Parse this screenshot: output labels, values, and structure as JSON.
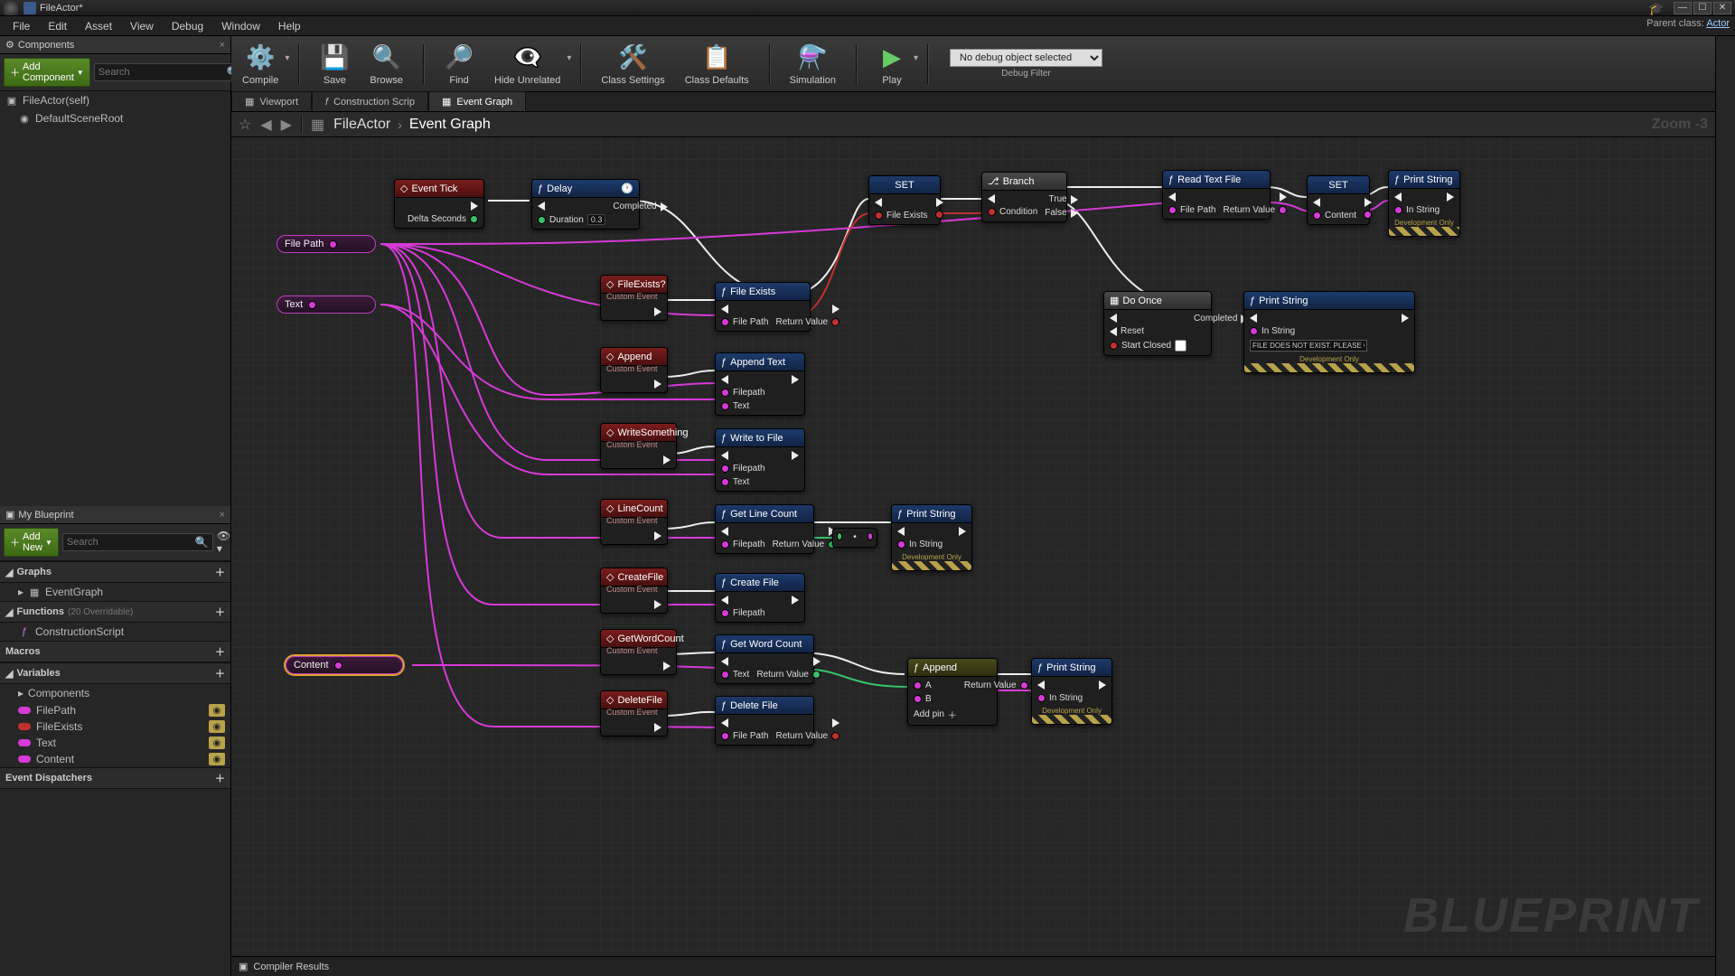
{
  "title": "FileActor*",
  "parentClassLabel": "Parent class:",
  "parentClass": "Actor",
  "menus": [
    "File",
    "Edit",
    "Asset",
    "View",
    "Debug",
    "Window",
    "Help"
  ],
  "componentsPanel": {
    "tab": "Components",
    "addBtn": "Add Component",
    "search": "Search",
    "root": "FileActor(self)",
    "child": "DefaultSceneRoot"
  },
  "blueprintPanel": {
    "tab": "My Blueprint",
    "addBtn": "Add New",
    "search": "Search",
    "graphs": "Graphs",
    "eventGraph": "EventGraph",
    "functions": "Functions",
    "functionsSub": "(20 Overridable)",
    "construction": "ConstructionScript",
    "macros": "Macros",
    "variables": "Variables",
    "componentsCat": "Components",
    "vars": [
      "FilePath",
      "FileExists",
      "Text",
      "Content"
    ],
    "dispatchers": "Event Dispatchers"
  },
  "toolbar": {
    "compile": "Compile",
    "save": "Save",
    "browse": "Browse",
    "find": "Find",
    "hide": "Hide Unrelated",
    "settings": "Class Settings",
    "defaults": "Class Defaults",
    "simulation": "Simulation",
    "play": "Play",
    "debugSel": "No debug object selected",
    "debugLabel": "Debug Filter"
  },
  "docTabs": {
    "viewport": "Viewport",
    "construction": "Construction Scrip",
    "eventGraph": "Event Graph"
  },
  "crumb": {
    "file": "FileActor",
    "graph": "Event Graph",
    "zoom": "Zoom  -3"
  },
  "compiler": "Compiler Results",
  "watermark": "BLUEPRINT",
  "nodes": {
    "eventTick": {
      "title": "Event Tick",
      "delta": "Delta Seconds"
    },
    "delay": {
      "title": "Delay",
      "duration": "Duration",
      "durVal": "0.3",
      "completed": "Completed"
    },
    "filePath": "File Path",
    "text": "Text",
    "content": "Content",
    "fileExistsEvt": {
      "title": "FileExists?",
      "sub": "Custom Event"
    },
    "fileExists": {
      "title": "File Exists",
      "path": "File Path",
      "ret": "Return Value"
    },
    "set": {
      "title": "SET",
      "var": "File Exists"
    },
    "branch": {
      "title": "Branch",
      "cond": "Condition",
      "t": "True",
      "f": "False"
    },
    "readText": {
      "title": "Read Text File",
      "path": "File Path",
      "ret": "Return Value"
    },
    "set2": {
      "title": "SET",
      "var": "Content"
    },
    "printStr": {
      "title": "Print String",
      "in": "In String",
      "dev": "Development Only"
    },
    "doOnce": {
      "title": "Do Once",
      "reset": "Reset",
      "start": "Start Closed",
      "completed": "Completed"
    },
    "printErr": {
      "title": "Print String",
      "in": "In String",
      "val": "FILE DOES NOT EXIST. PLEASE CHECK FILEPATH!!",
      "dev": "Development Only"
    },
    "appendEvt": {
      "title": "Append",
      "sub": "Custom Event"
    },
    "appendText": {
      "title": "Append Text",
      "path": "Filepath",
      "text": "Text"
    },
    "writeEvt": {
      "title": "WriteSomething",
      "sub": "Custom Event"
    },
    "writeFile": {
      "title": "Write to File",
      "path": "Filepath",
      "text": "Text"
    },
    "lineCountEvt": {
      "title": "LineCount",
      "sub": "Custom Event"
    },
    "getLine": {
      "title": "Get Line Count",
      "path": "Filepath",
      "ret": "Return Value"
    },
    "printLine": {
      "title": "Print String",
      "in": "In String",
      "dev": "Development Only"
    },
    "createEvt": {
      "title": "CreateFile",
      "sub": "Custom Event"
    },
    "createFile": {
      "title": "Create File",
      "path": "Filepath"
    },
    "wordCountEvt": {
      "title": "GetWordCount",
      "sub": "Custom Event"
    },
    "getWord": {
      "title": "Get Word Count",
      "text": "Text",
      "ret": "Return Value"
    },
    "appendStr": {
      "title": "Append",
      "a": "A",
      "b": "B",
      "ret": "Return Value",
      "add": "Add pin"
    },
    "printWord": {
      "title": "Print String",
      "in": "In String",
      "dev": "Development Only"
    },
    "deleteEvt": {
      "title": "DeleteFile",
      "sub": "Custom Event"
    },
    "deleteFile": {
      "title": "Delete File",
      "path": "File Path",
      "ret": "Return Value"
    }
  }
}
